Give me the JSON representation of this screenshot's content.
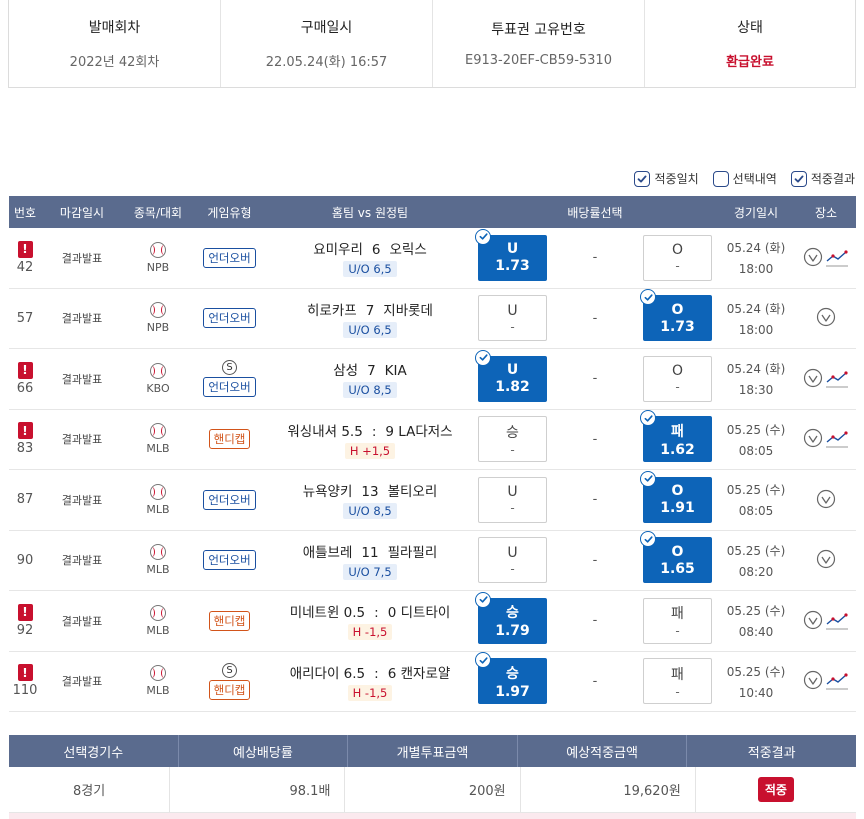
{
  "summary": [
    {
      "label": "발매회차",
      "value": "2022년 42회차"
    },
    {
      "label": "구매일시",
      "value": "22.05.24(화) 16:57"
    },
    {
      "label": "투표권 고유번호",
      "value": "E913-20EF-CB59-5310"
    },
    {
      "label": "상태",
      "value": "환급완료"
    }
  ],
  "filters": [
    {
      "label": "적중일치",
      "checked": true
    },
    {
      "label": "선택내역",
      "checked": false
    },
    {
      "label": "적중결과",
      "checked": true
    }
  ],
  "headers": [
    "번호",
    "마감일시",
    "종목/대회",
    "게임유형",
    "홈팀 vs 원정팀",
    "배당률선택",
    "경기일시",
    "장소"
  ],
  "rows": [
    {
      "no": "42",
      "alert": true,
      "close": "결과발표",
      "league": "NPB",
      "special": false,
      "type": "언더오버",
      "type_kind": "uo",
      "home": "요미우리",
      "score": "6",
      "away": "오릭스",
      "sub": "U/O 6,5",
      "sub_kind": "uo",
      "left": {
        "label": "U",
        "val": "1.73",
        "sel": true
      },
      "mid": "-",
      "right": {
        "label": "O",
        "val": "-",
        "sel": false
      },
      "date": "05.24 (화)",
      "time": "18:00",
      "graph": true
    },
    {
      "no": "57",
      "alert": false,
      "close": "결과발표",
      "league": "NPB",
      "special": false,
      "type": "언더오버",
      "type_kind": "uo",
      "home": "히로카프",
      "score": "7",
      "away": "지바롯데",
      "sub": "U/O 6,5",
      "sub_kind": "uo",
      "left": {
        "label": "U",
        "val": "-",
        "sel": false
      },
      "mid": "-",
      "right": {
        "label": "O",
        "val": "1.73",
        "sel": true
      },
      "date": "05.24 (화)",
      "time": "18:00",
      "graph": false
    },
    {
      "no": "66",
      "alert": true,
      "close": "결과발표",
      "league": "KBO",
      "special": true,
      "special_label": "S",
      "type": "언더오버",
      "type_kind": "uo",
      "home": "삼성",
      "score": "7",
      "away": "KIA",
      "sub": "U/O 8,5",
      "sub_kind": "uo",
      "left": {
        "label": "U",
        "val": "1.82",
        "sel": true
      },
      "mid": "-",
      "right": {
        "label": "O",
        "val": "-",
        "sel": false
      },
      "date": "05.24 (화)",
      "time": "18:30",
      "graph": true
    },
    {
      "no": "83",
      "alert": true,
      "close": "결과발표",
      "league": "MLB",
      "special": false,
      "type": "핸디캡",
      "type_kind": "hc",
      "home": "워싱내셔 5.5",
      "score": ":",
      "away": "9 LA다저스",
      "sub": "H +1,5",
      "sub_kind": "h",
      "left": {
        "label": "승",
        "val": "-",
        "sel": false
      },
      "mid": "-",
      "right": {
        "label": "패",
        "val": "1.62",
        "sel": true
      },
      "date": "05.25 (수)",
      "time": "08:05",
      "graph": true
    },
    {
      "no": "87",
      "alert": false,
      "close": "결과발표",
      "league": "MLB",
      "special": false,
      "type": "언더오버",
      "type_kind": "uo",
      "home": "뉴욕양키",
      "score": "13",
      "away": "볼티오리",
      "sub": "U/O 8,5",
      "sub_kind": "uo",
      "left": {
        "label": "U",
        "val": "-",
        "sel": false
      },
      "mid": "-",
      "right": {
        "label": "O",
        "val": "1.91",
        "sel": true
      },
      "date": "05.25 (수)",
      "time": "08:05",
      "graph": false
    },
    {
      "no": "90",
      "alert": false,
      "close": "결과발표",
      "league": "MLB",
      "special": false,
      "type": "언더오버",
      "type_kind": "uo",
      "home": "애틀브레",
      "score": "11",
      "away": "필라필리",
      "sub": "U/O 7,5",
      "sub_kind": "uo",
      "left": {
        "label": "U",
        "val": "-",
        "sel": false
      },
      "mid": "-",
      "right": {
        "label": "O",
        "val": "1.65",
        "sel": true
      },
      "date": "05.25 (수)",
      "time": "08:20",
      "graph": false
    },
    {
      "no": "92",
      "alert": true,
      "close": "결과발표",
      "league": "MLB",
      "special": false,
      "type": "핸디캡",
      "type_kind": "hc",
      "home": "미네트윈 0.5",
      "score": ":",
      "away": "0 디트타이",
      "sub": "H -1,5",
      "sub_kind": "h",
      "left": {
        "label": "승",
        "val": "1.79",
        "sel": true
      },
      "mid": "-",
      "right": {
        "label": "패",
        "val": "-",
        "sel": false
      },
      "date": "05.25 (수)",
      "time": "08:40",
      "graph": true
    },
    {
      "no": "110",
      "alert": true,
      "close": "결과발표",
      "league": "MLB",
      "special": true,
      "special_label": "S",
      "type": "핸디캡",
      "type_kind": "hc",
      "home": "애리다이 6.5",
      "score": ":",
      "away": "6 캔자로얄",
      "sub": "H -1,5",
      "sub_kind": "h",
      "left": {
        "label": "승",
        "val": "1.97",
        "sel": true
      },
      "mid": "-",
      "right": {
        "label": "패",
        "val": "-",
        "sel": false
      },
      "date": "05.25 (수)",
      "time": "10:40",
      "graph": true
    }
  ],
  "footer": {
    "headers": [
      "선택경기수",
      "예상배당률",
      "개별투표금액",
      "예상적중금액",
      "적중결과"
    ],
    "values": [
      "8경기",
      "98.1배",
      "200원",
      "19,620원",
      "적중"
    ]
  },
  "colors": {
    "header_bg": "#5a6b8e",
    "selected": "#0d64b8",
    "alert": "#c8102e",
    "handicap": "#d2541a"
  }
}
